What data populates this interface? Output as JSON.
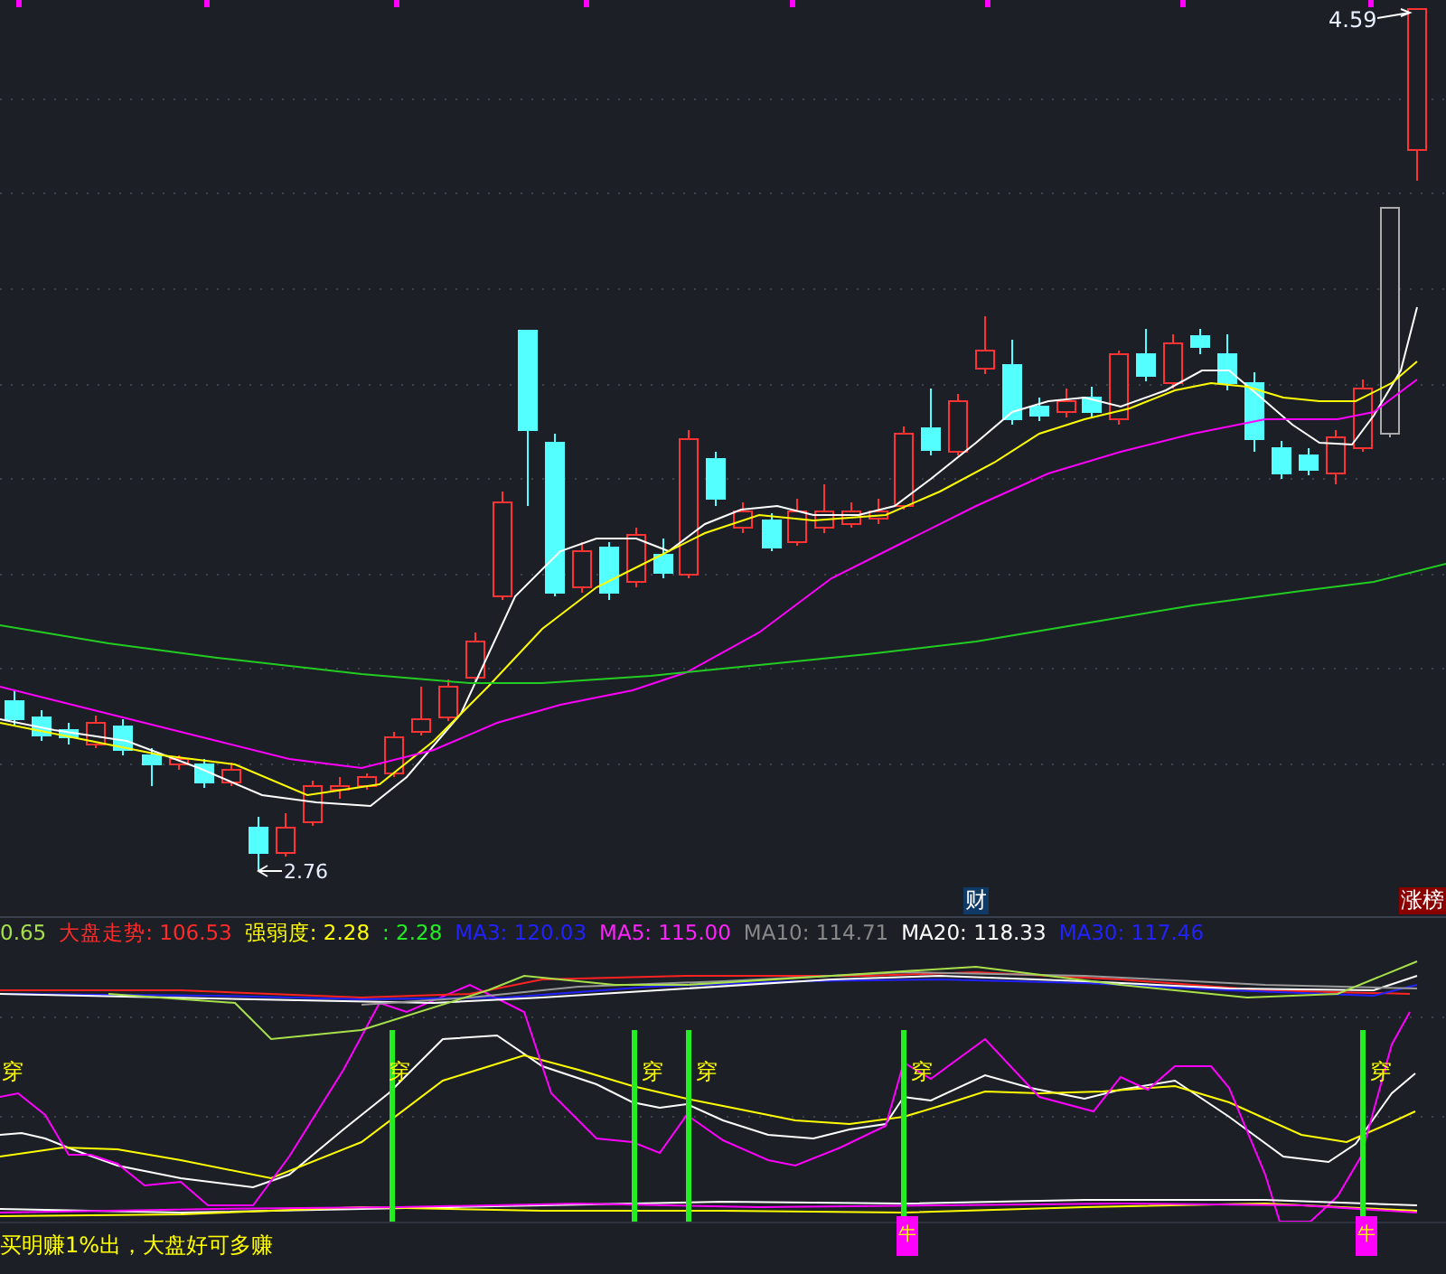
{
  "main_chart": {
    "high_label": "4.59",
    "low_label": "2.76"
  },
  "markers": [
    {
      "kind": "news",
      "text": "财"
    },
    {
      "kind": "rank",
      "text": "涨榜"
    }
  ],
  "legend": [
    {
      "text": "0.65",
      "color": "#a8e04a"
    },
    {
      "text": "大盘走势: 106.53",
      "color": "#ff2a2a"
    },
    {
      "text": "强弱度: 2.28",
      "color": "#ffff00"
    },
    {
      "text": ": 2.28",
      "color": "#22ee22"
    },
    {
      "text": "MA3: 120.03",
      "color": "#2222ff"
    },
    {
      "text": "MA5: 115.00",
      "color": "#ff22ff"
    },
    {
      "text": "MA10: 114.71",
      "color": "#888888"
    },
    {
      "text": "MA20: 118.33",
      "color": "#ffffff"
    },
    {
      "text": "MA30: 117.46",
      "color": "#2222ff"
    }
  ],
  "indicator": {
    "cross_labels": [
      "穿",
      "穿",
      "穿",
      "穿",
      "穿",
      "穿"
    ],
    "bull_tags": [
      "牛",
      "牛"
    ]
  },
  "note": "买明赚1%出，大盘好可多赚"
}
